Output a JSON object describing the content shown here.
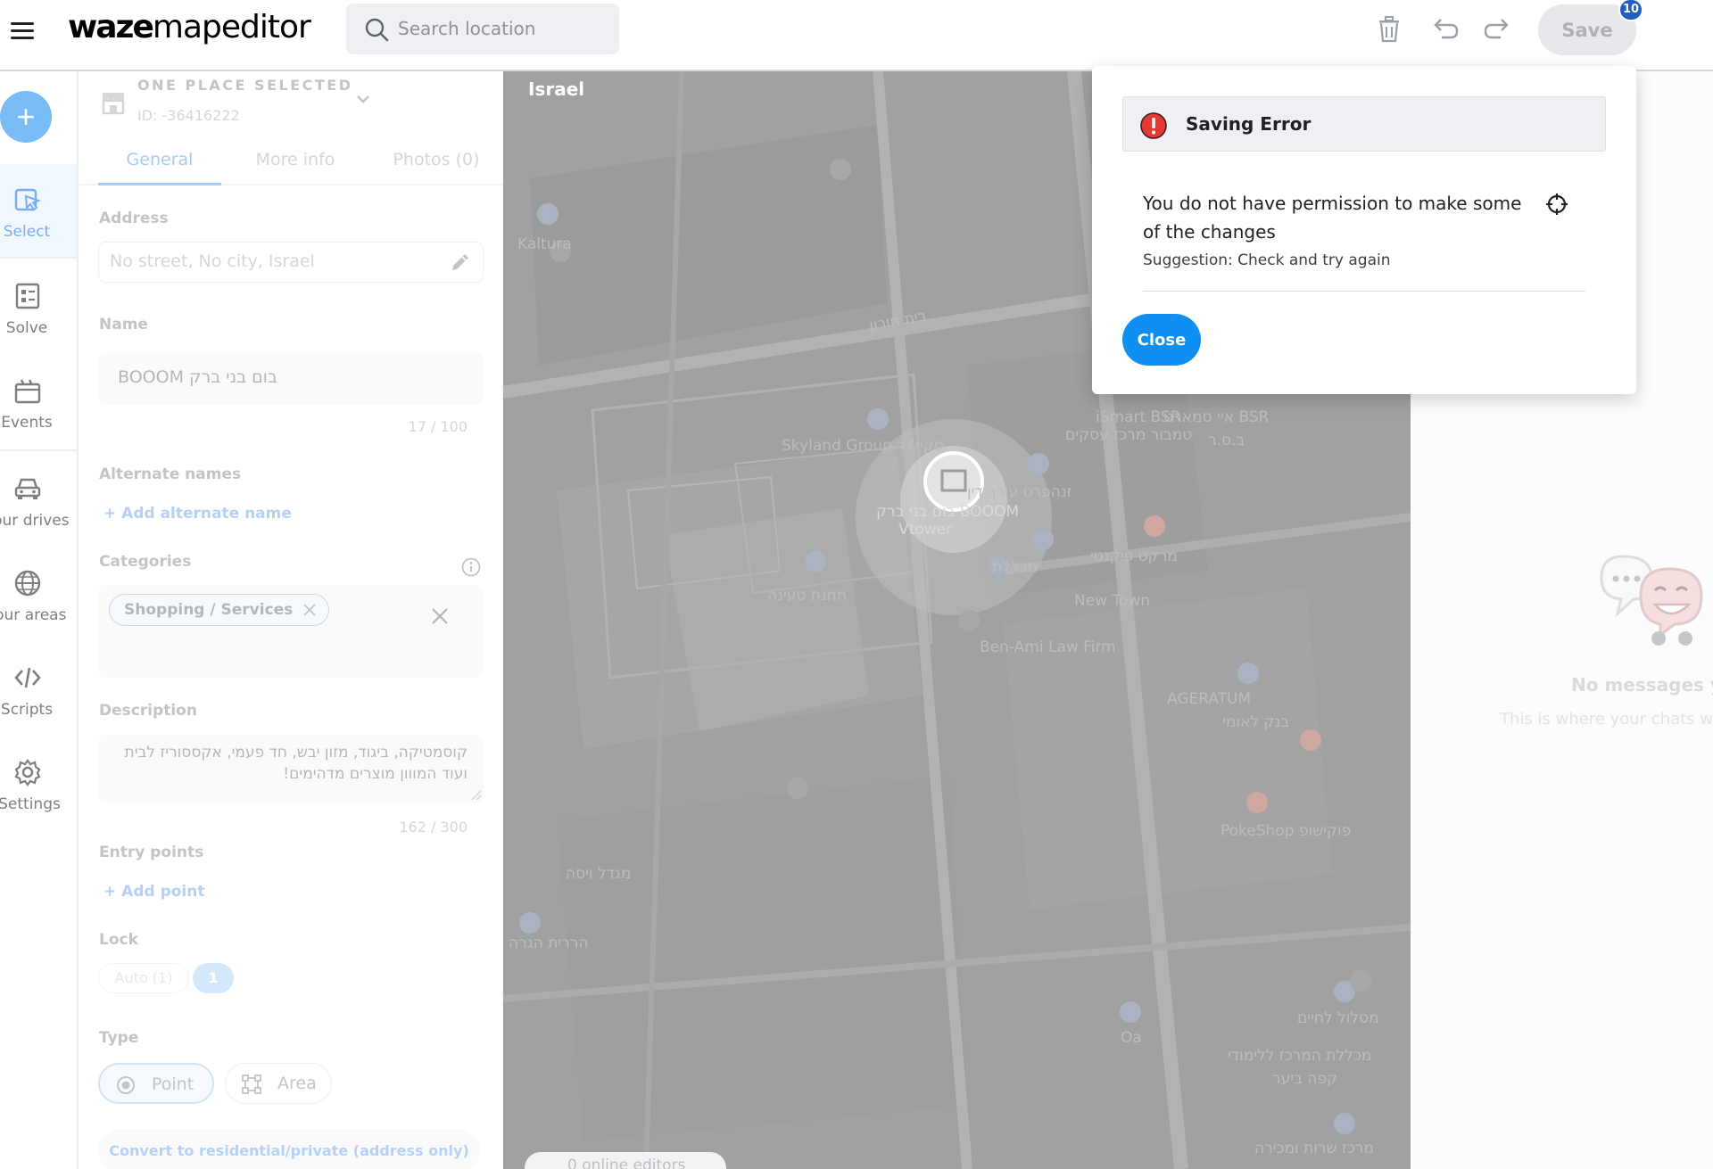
{
  "app": {
    "logo_bold": "waze",
    "logo_light": "mapeditor"
  },
  "search": {
    "placeholder": "Search location"
  },
  "toolbar": {
    "save_label": "Save",
    "pending_count": "10"
  },
  "rail": {
    "items": [
      {
        "label": "Select"
      },
      {
        "label": "Solve"
      },
      {
        "label": "Events"
      },
      {
        "label": "Your drives"
      },
      {
        "label": "Your areas"
      },
      {
        "label": "Scripts"
      },
      {
        "label": "Settings"
      }
    ]
  },
  "panel": {
    "selection_title": "ONE PLACE SELECTED",
    "selection_id": "ID: -36416222",
    "tabs": [
      {
        "label": "General"
      },
      {
        "label": "More info"
      },
      {
        "label": "Photos (0)"
      }
    ],
    "address_label": "Address",
    "address_value": "No street, No city, Israel",
    "name_label": "Name",
    "name_value": "בום בני ברק BOOOM",
    "name_counter": "17 / 100",
    "alt_names_label": "Alternate names",
    "add_alt_name": "+ Add alternate name",
    "categories_label": "Categories",
    "category_chip": "Shopping / Services",
    "description_label": "Description",
    "description_value": "קוסמטיקה, ביגוד, מזון יבש, חד פעמי, אקססוריז לבית ועוד המווון מוצרים מדהימים!",
    "description_counter": "162 / 300",
    "entry_points_label": "Entry points",
    "add_point": "+ Add point",
    "lock_label": "Lock",
    "lock_auto": "Auto (1)",
    "lock_level": "1",
    "type_label": "Type",
    "type_point": "Point",
    "type_area": "Area",
    "convert_label": "Convert to residential/private (address only)"
  },
  "map": {
    "country": "Israel",
    "online_editors": "0 online editors",
    "labels": [
      "Kaltura",
      "בית חורון",
      "Skyland Group סקילנד",
      "בום בני ברק BOOOM",
      "Vtower",
      "זנהפרט עורך דין",
      "איי סמארט BSR",
      "iSmart BSR",
      "טמבור מרכז עסקים",
      "ב.ס.ר",
      "תחנת טעינה",
      "מרקט פיקנטי",
      "מכללת",
      "New Town",
      "Ben-Ami Law Firm",
      "AGERATUM",
      "בנק לאומי",
      "PokeShop פוקישופ",
      "מגדל ויסה",
      "הררית הגרה",
      "מסלול לחיים",
      "מכללת המרכז ללימודי",
      "קפה ביער",
      "Oa",
      "מרכז שרות ומכירה"
    ],
    "colors": {
      "map_bg": "#5f5f5f",
      "road": "#7c7c7c"
    }
  },
  "chat": {
    "empty_title": "No messages yet",
    "empty_sub": "This is where your chats will appear"
  },
  "dialog": {
    "title": "Saving Error",
    "message": "You do not have permission to make some of the changes",
    "suggestion": "Suggestion: Check and try again",
    "close_label": "Close"
  },
  "colors": {
    "accent": "#1a73e8",
    "error": "#e53935",
    "primary_button": "#0f8ff2"
  }
}
